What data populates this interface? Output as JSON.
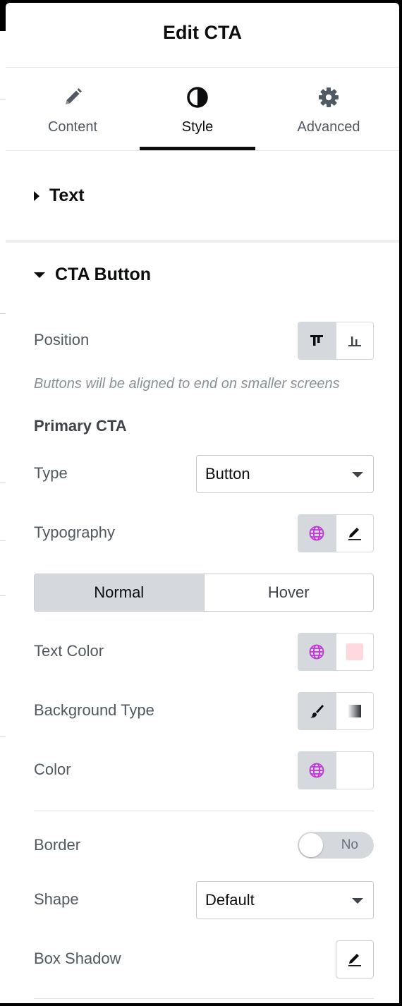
{
  "header": {
    "title": "Edit CTA"
  },
  "tabs": [
    {
      "label": "Content",
      "icon": "pencil-icon"
    },
    {
      "label": "Style",
      "icon": "contrast-icon",
      "active": true
    },
    {
      "label": "Advanced",
      "icon": "gear-icon"
    }
  ],
  "sections": {
    "text": {
      "label": "Text",
      "expanded": false
    },
    "cta_button": {
      "label": "CTA Button",
      "expanded": true
    }
  },
  "cta": {
    "position_label": "Position",
    "position_options": [
      {
        "icon": "align-top-icon",
        "selected": true
      },
      {
        "icon": "align-bottom-icon",
        "selected": false
      }
    ],
    "position_note": "Buttons will be aligned to end on smaller screens",
    "primary_heading": "Primary CTA",
    "type_label": "Type",
    "type_value": "Button",
    "typography_label": "Typography",
    "state_tabs": [
      {
        "label": "Normal",
        "selected": true
      },
      {
        "label": "Hover",
        "selected": false
      }
    ],
    "text_color_label": "Text Color",
    "text_color_value": "#ffd9de",
    "background_type_label": "Background Type",
    "color_label": "Color",
    "color_value": "#ffffff",
    "border_label": "Border",
    "border_toggle": "No",
    "shape_label": "Shape",
    "shape_value": "Default",
    "box_shadow_label": "Box Shadow"
  },
  "colors": {
    "accent_global": "#c036d9",
    "selected_bg": "#d5d8dc",
    "text_dark": "#0c0d0e"
  }
}
